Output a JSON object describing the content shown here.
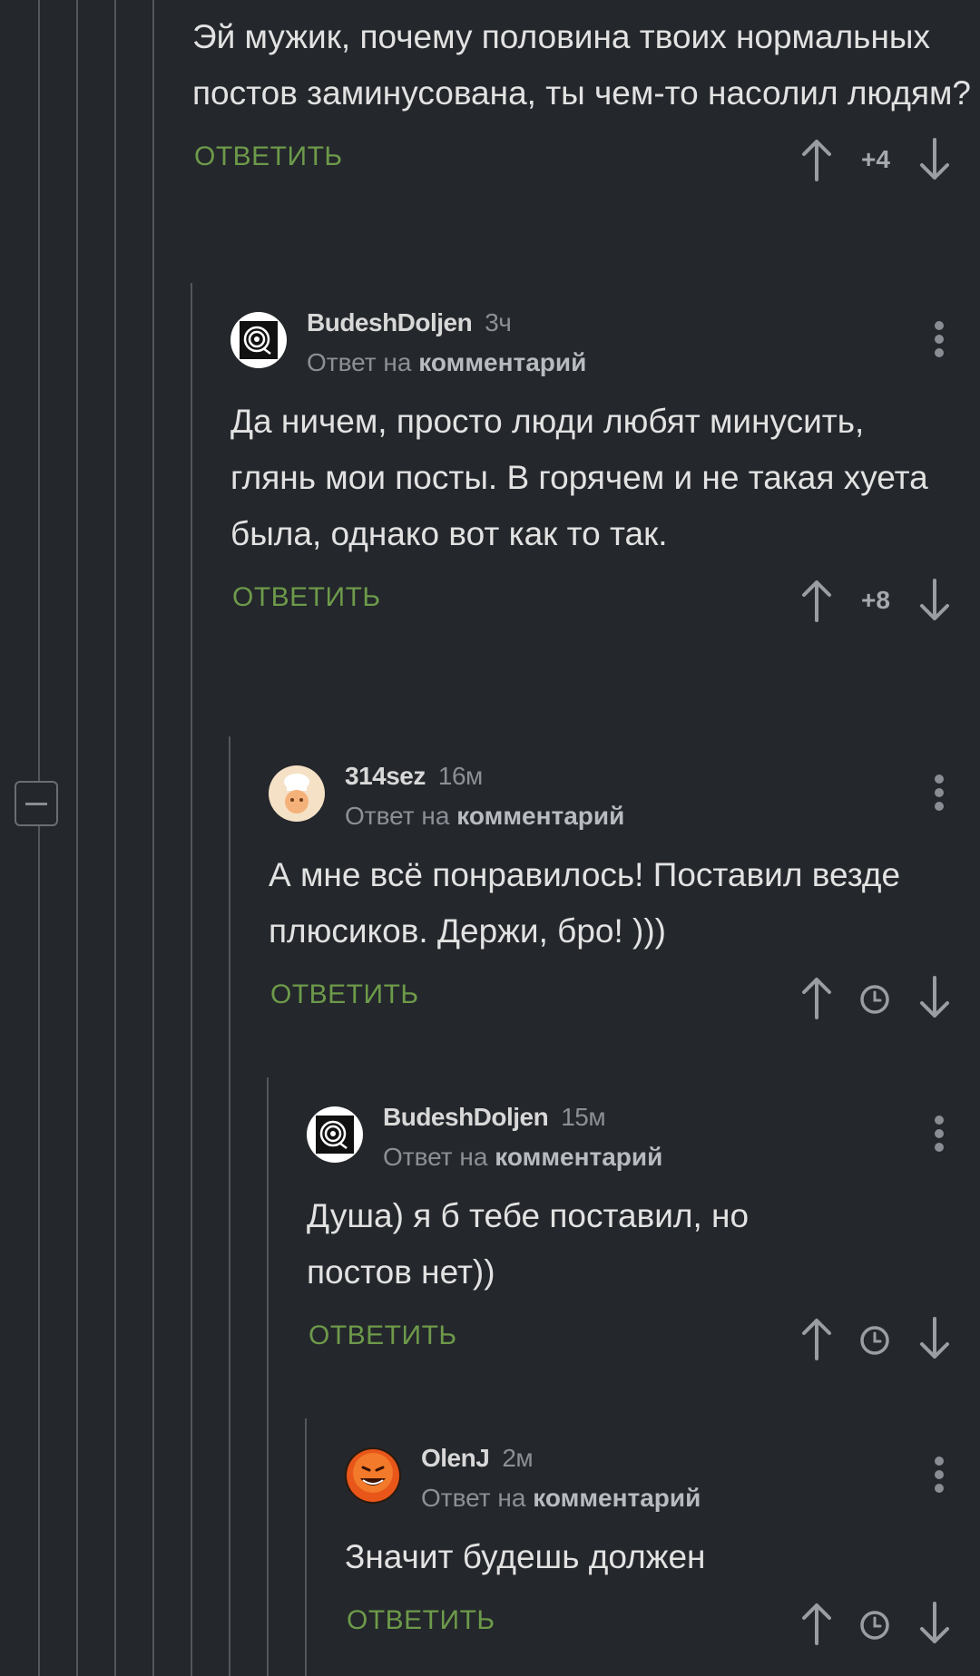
{
  "comments": [
    {
      "id": "c0",
      "text": "Эй мужик, почему половина твоих нормальных постов заминусована, ты чем-то насолил людям?",
      "reply_label": "ОТВЕТИТЬ",
      "score": "+4"
    },
    {
      "id": "c1",
      "author": "BudeshDoljen",
      "time": "3ч",
      "reply_prefix": "Ответ на",
      "reply_target": "комментарий",
      "text": "Да ничем, просто люди любят минусить, глянь мои посты. В горячем и не такая хуета была, однако вот как то так.",
      "reply_label": "ОТВЕТИТЬ",
      "score": "+8",
      "avatar": "labyrinth-avatar"
    },
    {
      "id": "c2",
      "author": "314sez",
      "time": "16м",
      "reply_prefix": "Ответ на",
      "reply_target": "комментарий",
      "text": "А мне всё понравилось! Поставил везде плюсиков. Держи, бро! )))",
      "reply_label": "ОТВЕТИТЬ",
      "avatar": "chef-avatar"
    },
    {
      "id": "c3",
      "author": "BudeshDoljen",
      "time": "15м",
      "reply_prefix": "Ответ на",
      "reply_target": "комментарий",
      "text": "Душа) я б тебе поставил, но постов нет))",
      "reply_label": "ОТВЕТИТЬ",
      "avatar": "labyrinth-avatar"
    },
    {
      "id": "c4",
      "author": "OlenJ",
      "time": "2м",
      "reply_prefix": "Ответ на",
      "reply_target": "комментарий",
      "text": "Значит будешь должен",
      "reply_label": "ОТВЕТИТЬ",
      "avatar": "orange-face-avatar"
    }
  ],
  "colors": {
    "background": "#24272b",
    "reply_green": "#6d9a4a",
    "thread_line": "#53575d",
    "text": "#e2e2e2",
    "muted": "#8c9096"
  },
  "icons": [
    "arrow-up-icon",
    "arrow-down-icon",
    "clock-icon",
    "more-icon",
    "collapse-icon"
  ]
}
